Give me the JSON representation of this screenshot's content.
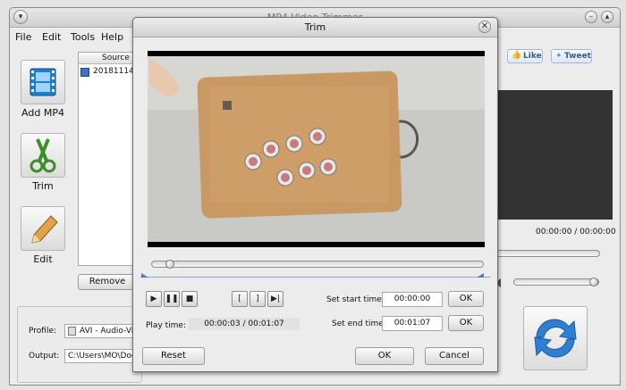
{
  "main": {
    "title": "MP4 Video Trimmer",
    "menu": [
      "File",
      "Edit",
      "Tools",
      "Help"
    ],
    "buttons": {
      "add": "Add MP4",
      "trim": "Trim",
      "edit": "Edit"
    },
    "list": {
      "header": "Source",
      "item": "20181114_"
    },
    "remove_label": "Remove",
    "profile_label": "Profile:",
    "profile_value": "AVI - Audio-Vi",
    "output_label": "Output:",
    "output_value": "C:\\Users\\MO\\Docu",
    "like_label": "Like",
    "tweet_label": "Tweet",
    "time_readout": "00:00:00 / 00:00:00"
  },
  "trim": {
    "title": "Trim",
    "play_time_label": "Play time:",
    "play_time_value": "00:00:03 / 00:01:07",
    "set_start_label": "Set start time:",
    "start_value": "00:00:00",
    "set_end_label": "Set end time:",
    "end_value": "00:01:07",
    "ok_label": "OK",
    "reset_label": "Reset",
    "dialog_ok_label": "OK",
    "cancel_label": "Cancel",
    "seek_fraction": 0.045
  },
  "icons": [
    "film-icon",
    "scissors-icon",
    "pencil-icon",
    "convert-icon",
    "play-icon",
    "pause-icon",
    "stop-icon",
    "set-start-icon",
    "set-end-icon",
    "jump-end-icon",
    "close-icon",
    "minimize-icon",
    "maximize-icon",
    "menu-icon",
    "like-icon",
    "twitter-icon",
    "file-icon"
  ]
}
